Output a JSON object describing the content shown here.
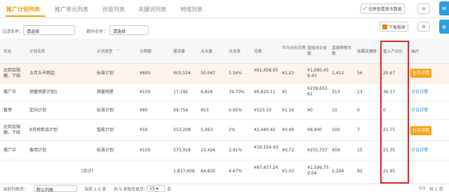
{
  "tabs": [
    "推广计划列表",
    "推广单元列表",
    "创意列表",
    "关键词列表",
    "地域列表"
  ],
  "toolbar": {
    "fullscreen_label": "全屏查看更多数据",
    "download_label": "下载报表"
  },
  "filters": {
    "filter_label": "过滤条件：",
    "filter_value": "请选择",
    "sub_label": "细分条件：",
    "sub_value": "请选择"
  },
  "headers": [
    "状态",
    "计划名称",
    "计划类型",
    "日限额",
    "展现量",
    "点击量",
    "点击率",
    "花费",
    "平均点击花费",
    "直接成交金额",
    "直接购物车数",
    "收藏店铺数",
    "投入产出比",
    "操作"
  ],
  "rows": [
    {
      "status": "达到日限额、下线",
      "name": "五月五号新起",
      "type": "标准计划",
      "budget": "¥600",
      "impressions": "903,534",
      "clicks": "50,067",
      "ctr": "5.54%",
      "cost": "¥61,458.95",
      "cpc": "¥1.23",
      "gmv": "¥1,095,459.43",
      "cart": "1,412",
      "fav": "56",
      "roi": "20.67",
      "op": "分日详情"
    },
    {
      "status": "推广中",
      "name": "销量明星计划1",
      "type": "销量明星",
      "budget": "¥150",
      "impressions": "17,192",
      "clicks": "6,826",
      "ctr": "39.70%",
      "cost": "¥6,820.11",
      "cpc": "¥1",
      "gmv": "¥239,653.61",
      "cart": "313",
      "fav": "13",
      "roi": "36.57",
      "op": "分日详情"
    },
    {
      "status": "暂停",
      "name": "定向计划",
      "type": "标准计划",
      "budget": "¥80",
      "impressions": "69,754",
      "clicks": "453",
      "ctr": "0.65%",
      "cost": "¥523.33",
      "cpc": "¥1.16",
      "gmv": "¥0",
      "cart": "10",
      "fav": "0",
      "roi": "0",
      "op": "分日详情"
    },
    {
      "status": "达到日限额、下线",
      "name": "8月抢新品计划",
      "type": "智能计划",
      "budget": "¥50",
      "impressions": "253,208",
      "clicks": "5,063",
      "ctr": "2%",
      "cost": "¥2,480.42",
      "cpc": "¥0.49",
      "gmv": "¥8,900",
      "cart": "100",
      "fav": "7",
      "roi": "21.75",
      "op": "分日详情"
    },
    {
      "status": "推广中",
      "name": "备用计划",
      "type": "标准计划",
      "budget": "¥150",
      "impressions": "573,918",
      "clicks": "22,426",
      "ctr": "3.91%",
      "cost": "¥16,154.43",
      "cpc": "¥0.72",
      "gmv": "¥255,737",
      "cart": "459",
      "fav": "15",
      "roi": "21.35",
      "op": "分日详情"
    }
  ],
  "total": {
    "label": "(合计)",
    "impressions": "1,817,606",
    "clicks": "84,835",
    "ctr": "4.67%",
    "cost": "¥87,437.24",
    "cpc": "¥1.03",
    "gmv": "¥1,599,750.04",
    "cart": "2,294",
    "fav": "92",
    "roi": "21.95"
  },
  "footer": {
    "view_label": "当前列表页：",
    "view_value": "默认列表",
    "range": "当前 1-5 条",
    "total": "共 5 条",
    "per_page_label": "每页显示：",
    "per_page": "15",
    "count_suffix": "条",
    "page_info": "1/1",
    "pages": "共 1 页"
  },
  "colors": {
    "accent": "#f39c12",
    "button": "#f5a623",
    "link": "#2d8cd8",
    "highlight_box": "#d9302c",
    "side_button": "#2d9ee0"
  }
}
